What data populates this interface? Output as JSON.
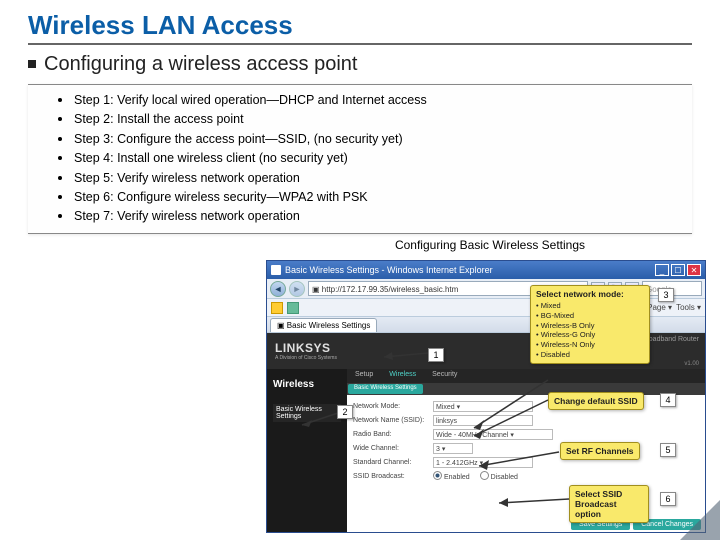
{
  "title": "Wireless LAN Access",
  "subtitle": "Configuring a wireless access point",
  "steps": [
    "Step 1: Verify local wired operation—DHCP and Internet access",
    "Step 2: Install the access point",
    "Step 3: Configure the access point—SSID, (no security yet)",
    "Step 4: Install one wireless client (no security yet)",
    "Step 5: Verify wireless network operation",
    "Step 6: Configure wireless security—WPA2 with PSK",
    "Step 7: Verify wireless network operation"
  ],
  "caption": "Configuring Basic Wireless Settings",
  "browser": {
    "window_title": "Basic Wireless Settings - Windows Internet Explorer",
    "url": "http://172.17.99.35/wireless_basic.htm",
    "search_placeholder": "Google",
    "tab_label": "Basic Wireless Settings",
    "tool_page": "Page",
    "tool_tools": "Tools"
  },
  "router": {
    "logo": "LINKSYS",
    "logo_sub": "A Division of Cisco Systems",
    "model": "Wireless-N Broadband Router",
    "fw": "v1.00",
    "side_title": "Wireless",
    "side_sub": "Basic Wireless Settings",
    "nav": {
      "setup": "Setup",
      "wireless": "Wireless",
      "security": "Security"
    },
    "subnav": {
      "basic": "Basic Wireless Settings"
    },
    "fields": {
      "mode_label": "Network Mode:",
      "mode_value": "Mixed",
      "ssid_label": "Network Name (SSID):",
      "ssid_value": "linksys",
      "band_label": "Radio Band:",
      "band_value": "Wide - 40MHz Channel",
      "wide_label": "Wide Channel:",
      "wide_value": "3",
      "std_label": "Standard Channel:",
      "std_value": "1 - 2.412GHz",
      "bcast_label": "SSID Broadcast:",
      "bcast_enabled": "Enabled",
      "bcast_disabled": "Disabled"
    },
    "buttons": {
      "save": "Save Settings",
      "cancel": "Cancel Changes"
    }
  },
  "callouts": {
    "c3": {
      "title": "Select network mode:",
      "items": [
        "Mixed",
        "BG-Mixed",
        "Wireless-B Only",
        "Wireless-G Only",
        "Wireless-N Only",
        "Disabled"
      ]
    },
    "c4": "Change default SSID",
    "c5": "Set RF Channels",
    "c6": "Select SSID Broadcast option"
  },
  "nums": {
    "n1": "1",
    "n2": "2",
    "n3": "3",
    "n4": "4",
    "n5": "5",
    "n6": "6"
  }
}
